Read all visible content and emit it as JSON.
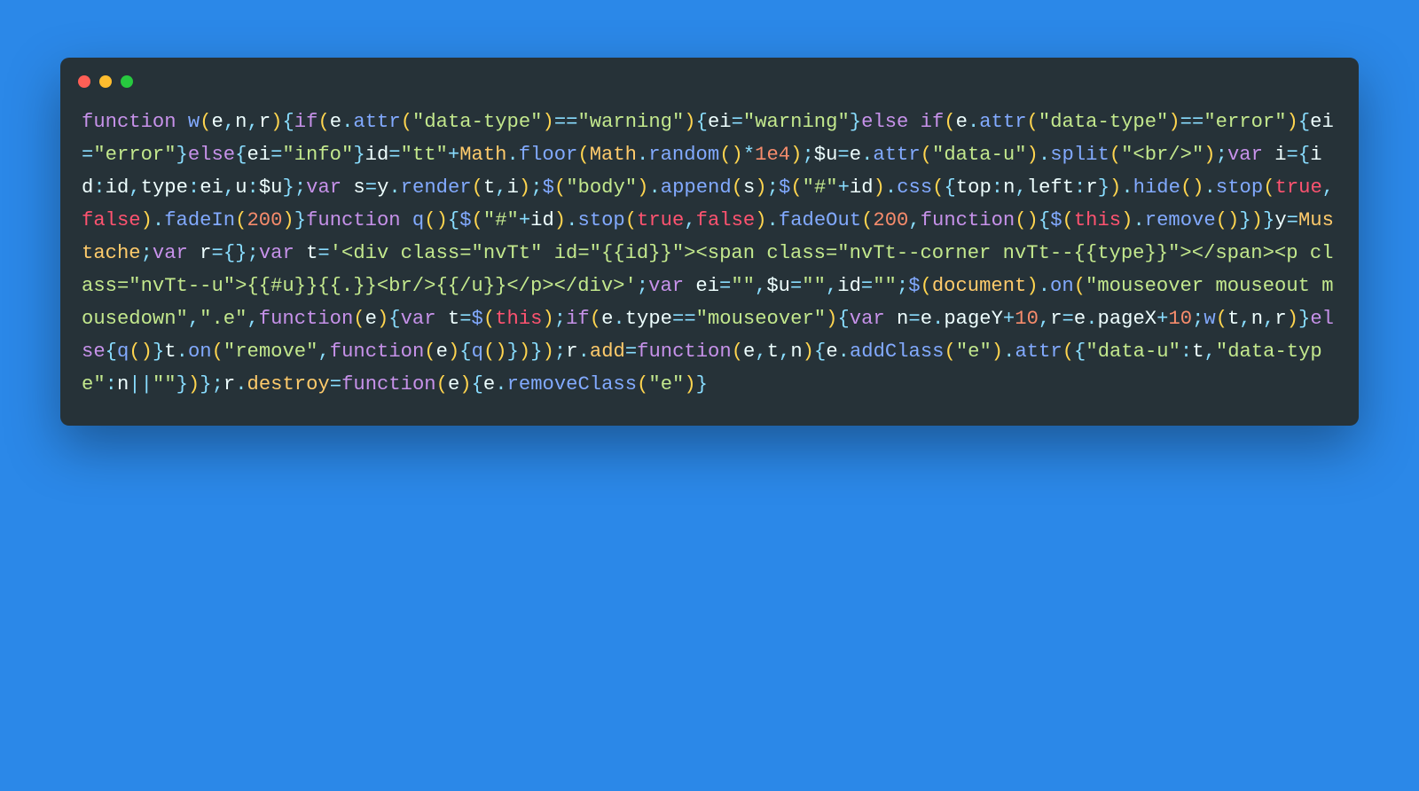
{
  "colors": {
    "page_bg": "#2b88e8",
    "window_bg": "#263238",
    "dot_red": "#ff5f56",
    "dot_yellow": "#ffbd2e",
    "dot_green": "#27c93f"
  },
  "syntax_colors": {
    "keyword": "#c792ea",
    "function": "#82aaff",
    "identifier": "#ffcb6b",
    "paren": "#ffd54f",
    "punct": "#89ddff",
    "string": "#c3e88d",
    "number": "#f78c6c",
    "plain": "#eeffff",
    "this_bool": "#ff5370"
  },
  "code": {
    "raw": "function w(e,n,r){if(e.attr(\"data-type\")==\"warning\"){ei=\"warning\"}else if(e.attr(\"data-type\")==\"error\"){ei=\"error\"}else{ei=\"info\"}id=\"tt\"+Math.floor(Math.random()*1e4);$u=e.attr(\"data-u\").split(\"<br/>\");var i={id:id,type:ei,u:$u};var s=y.render(t,i);$(\"body\").append(s);$(\"#\"+id).css({top:n,left:r}).hide().stop(true,false).fadeIn(200)}function q(){$(\"#\"+id).stop(true,false).fadeOut(200,function(){$(this).remove()})}y=Mustache;var r={};var t='<div class=\"nvTt\" id=\"{{id}}\"><span class=\"nvTt--corner nvTt--{{type}}\"></span><p class=\"nvTt--u\">{{#u}}{{.}}<br/>{{/u}}</p></div>';var ei=\"\",$u=\"\",id=\"\";$(document).on(\"mouseover mouseout mousedown\",\".e\",function(e){var t=$(this);if(e.type==\"mouseover\"){var n=e.pageY+10,r=e.pageX+10;w(t,n,r)}else{q()}t.on(\"remove\",function(e){q()})});r.add=function(e,t,n){e.addClass(\"e\").attr({\"data-u\":t,\"data-type\":n||\"\"})};r.destroy=function(e){e.removeClass(\"e\")}",
    "tokens": [
      [
        "kw",
        "function "
      ],
      [
        "fn",
        "w"
      ],
      [
        "pr",
        "("
      ],
      [
        "pl",
        "e"
      ],
      [
        "pu",
        ","
      ],
      [
        "pl",
        "n"
      ],
      [
        "pu",
        ","
      ],
      [
        "pl",
        "r"
      ],
      [
        "pr",
        ")"
      ],
      [
        "br",
        "{"
      ],
      [
        "kw",
        "if"
      ],
      [
        "pr",
        "("
      ],
      [
        "pl",
        "e"
      ],
      [
        "pu",
        "."
      ],
      [
        "fn",
        "attr"
      ],
      [
        "pr",
        "("
      ],
      [
        "st",
        "\"data-type\""
      ],
      [
        "pr",
        ")"
      ],
      [
        "pu",
        "=="
      ],
      [
        "st",
        "\"warning\""
      ],
      [
        "pr",
        ")"
      ],
      [
        "br",
        "{"
      ],
      [
        "pl",
        "ei"
      ],
      [
        "pu",
        "="
      ],
      [
        "st",
        "\"warning\""
      ],
      [
        "br",
        "}"
      ],
      [
        "kw",
        "else if"
      ],
      [
        "pr",
        "("
      ],
      [
        "pl",
        "e"
      ],
      [
        "pu",
        "."
      ],
      [
        "fn",
        "attr"
      ],
      [
        "pr",
        "("
      ],
      [
        "st",
        "\"data-type\""
      ],
      [
        "pr",
        ")"
      ],
      [
        "pu",
        "=="
      ],
      [
        "st",
        "\"error\""
      ],
      [
        "pr",
        ")"
      ],
      [
        "br",
        "{"
      ],
      [
        "pl",
        "ei"
      ],
      [
        "pu",
        "="
      ],
      [
        "st",
        "\"error\""
      ],
      [
        "br",
        "}"
      ],
      [
        "kw",
        "else"
      ],
      [
        "br",
        "{"
      ],
      [
        "pl",
        "ei"
      ],
      [
        "pu",
        "="
      ],
      [
        "st",
        "\"info\""
      ],
      [
        "br",
        "}"
      ],
      [
        "pl",
        "id"
      ],
      [
        "pu",
        "="
      ],
      [
        "st",
        "\"tt\""
      ],
      [
        "pu",
        "+"
      ],
      [
        "id",
        "Math"
      ],
      [
        "pu",
        "."
      ],
      [
        "fn",
        "floor"
      ],
      [
        "pr",
        "("
      ],
      [
        "id",
        "Math"
      ],
      [
        "pu",
        "."
      ],
      [
        "fn",
        "random"
      ],
      [
        "pr",
        "("
      ],
      [
        "pr",
        ")"
      ],
      [
        "pu",
        "*"
      ],
      [
        "nu",
        "1e4"
      ],
      [
        "pr",
        ")"
      ],
      [
        "pu",
        ";"
      ],
      [
        "pl",
        "$u"
      ],
      [
        "pu",
        "="
      ],
      [
        "pl",
        "e"
      ],
      [
        "pu",
        "."
      ],
      [
        "fn",
        "attr"
      ],
      [
        "pr",
        "("
      ],
      [
        "st",
        "\"data-u\""
      ],
      [
        "pr",
        ")"
      ],
      [
        "pu",
        "."
      ],
      [
        "fn",
        "split"
      ],
      [
        "pr",
        "("
      ],
      [
        "st",
        "\"<br/>\""
      ],
      [
        "pr",
        ")"
      ],
      [
        "pu",
        ";"
      ],
      [
        "kw",
        "var "
      ],
      [
        "pl",
        "i"
      ],
      [
        "pu",
        "="
      ],
      [
        "br",
        "{"
      ],
      [
        "pl",
        "id"
      ],
      [
        "pu",
        ":"
      ],
      [
        "pl",
        "id"
      ],
      [
        "pu",
        ","
      ],
      [
        "pl",
        "type"
      ],
      [
        "pu",
        ":"
      ],
      [
        "pl",
        "ei"
      ],
      [
        "pu",
        ","
      ],
      [
        "pl",
        "u"
      ],
      [
        "pu",
        ":"
      ],
      [
        "pl",
        "$u"
      ],
      [
        "br",
        "}"
      ],
      [
        "pu",
        ";"
      ],
      [
        "kw",
        "var "
      ],
      [
        "pl",
        "s"
      ],
      [
        "pu",
        "="
      ],
      [
        "pl",
        "y"
      ],
      [
        "pu",
        "."
      ],
      [
        "fn",
        "render"
      ],
      [
        "pr",
        "("
      ],
      [
        "pl",
        "t"
      ],
      [
        "pu",
        ","
      ],
      [
        "pl",
        "i"
      ],
      [
        "pr",
        ")"
      ],
      [
        "pu",
        ";"
      ],
      [
        "fn",
        "$"
      ],
      [
        "pr",
        "("
      ],
      [
        "st",
        "\"body\""
      ],
      [
        "pr",
        ")"
      ],
      [
        "pu",
        "."
      ],
      [
        "fn",
        "append"
      ],
      [
        "pr",
        "("
      ],
      [
        "pl",
        "s"
      ],
      [
        "pr",
        ")"
      ],
      [
        "pu",
        ";"
      ],
      [
        "fn",
        "$"
      ],
      [
        "pr",
        "("
      ],
      [
        "st",
        "\"#\""
      ],
      [
        "pu",
        "+"
      ],
      [
        "pl",
        "id"
      ],
      [
        "pr",
        ")"
      ],
      [
        "pu",
        "."
      ],
      [
        "fn",
        "css"
      ],
      [
        "pr",
        "("
      ],
      [
        "br",
        "{"
      ],
      [
        "pl",
        "top"
      ],
      [
        "pu",
        ":"
      ],
      [
        "pl",
        "n"
      ],
      [
        "pu",
        ","
      ],
      [
        "pl",
        "left"
      ],
      [
        "pu",
        ":"
      ],
      [
        "pl",
        "r"
      ],
      [
        "br",
        "}"
      ],
      [
        "pr",
        ")"
      ],
      [
        "pu",
        "."
      ],
      [
        "fn",
        "hide"
      ],
      [
        "pr",
        "("
      ],
      [
        "pr",
        ")"
      ],
      [
        "pu",
        "."
      ],
      [
        "fn",
        "stop"
      ],
      [
        "pr",
        "("
      ],
      [
        "th",
        "true"
      ],
      [
        "pu",
        ","
      ],
      [
        "th",
        "false"
      ],
      [
        "pr",
        ")"
      ],
      [
        "pu",
        "."
      ],
      [
        "fn",
        "fadeIn"
      ],
      [
        "pr",
        "("
      ],
      [
        "nu",
        "200"
      ],
      [
        "pr",
        ")"
      ],
      [
        "br",
        "}"
      ],
      [
        "kw",
        "function "
      ],
      [
        "fn",
        "q"
      ],
      [
        "pr",
        "("
      ],
      [
        "pr",
        ")"
      ],
      [
        "br",
        "{"
      ],
      [
        "fn",
        "$"
      ],
      [
        "pr",
        "("
      ],
      [
        "st",
        "\"#\""
      ],
      [
        "pu",
        "+"
      ],
      [
        "pl",
        "id"
      ],
      [
        "pr",
        ")"
      ],
      [
        "pu",
        "."
      ],
      [
        "fn",
        "stop"
      ],
      [
        "pr",
        "("
      ],
      [
        "th",
        "true"
      ],
      [
        "pu",
        ","
      ],
      [
        "th",
        "false"
      ],
      [
        "pr",
        ")"
      ],
      [
        "pu",
        "."
      ],
      [
        "fn",
        "fadeOut"
      ],
      [
        "pr",
        "("
      ],
      [
        "nu",
        "200"
      ],
      [
        "pu",
        ","
      ],
      [
        "kw",
        "function"
      ],
      [
        "pr",
        "("
      ],
      [
        "pr",
        ")"
      ],
      [
        "br",
        "{"
      ],
      [
        "fn",
        "$"
      ],
      [
        "pr",
        "("
      ],
      [
        "th",
        "this"
      ],
      [
        "pr",
        ")"
      ],
      [
        "pu",
        "."
      ],
      [
        "fn",
        "remove"
      ],
      [
        "pr",
        "("
      ],
      [
        "pr",
        ")"
      ],
      [
        "br",
        "}"
      ],
      [
        "pr",
        ")"
      ],
      [
        "br",
        "}"
      ],
      [
        "pl",
        "y"
      ],
      [
        "pu",
        "="
      ],
      [
        "id",
        "Mustache"
      ],
      [
        "pu",
        ";"
      ],
      [
        "kw",
        "var "
      ],
      [
        "pl",
        "r"
      ],
      [
        "pu",
        "="
      ],
      [
        "br",
        "{"
      ],
      [
        "br",
        "}"
      ],
      [
        "pu",
        ";"
      ],
      [
        "kw",
        "var "
      ],
      [
        "pl",
        "t"
      ],
      [
        "pu",
        "="
      ],
      [
        "st",
        "'<div class=\"nvTt\" id=\"{{id}}\"><span class=\"nvTt--corner nvTt--{{type}}\"></span><p class=\"nvTt--u\">{{#u}}{{.}}<br/>{{/u}}</p></div>'"
      ],
      [
        "pu",
        ";"
      ],
      [
        "kw",
        "var "
      ],
      [
        "pl",
        "ei"
      ],
      [
        "pu",
        "="
      ],
      [
        "st",
        "\"\""
      ],
      [
        "pu",
        ","
      ],
      [
        "pl",
        "$u"
      ],
      [
        "pu",
        "="
      ],
      [
        "st",
        "\"\""
      ],
      [
        "pu",
        ","
      ],
      [
        "pl",
        "id"
      ],
      [
        "pu",
        "="
      ],
      [
        "st",
        "\"\""
      ],
      [
        "pu",
        ";"
      ],
      [
        "fn",
        "$"
      ],
      [
        "pr",
        "("
      ],
      [
        "id",
        "document"
      ],
      [
        "pr",
        ")"
      ],
      [
        "pu",
        "."
      ],
      [
        "fn",
        "on"
      ],
      [
        "pr",
        "("
      ],
      [
        "st",
        "\"mouseover mouseout mousedown\""
      ],
      [
        "pu",
        ","
      ],
      [
        "st",
        "\".e\""
      ],
      [
        "pu",
        ","
      ],
      [
        "kw",
        "function"
      ],
      [
        "pr",
        "("
      ],
      [
        "pl",
        "e"
      ],
      [
        "pr",
        ")"
      ],
      [
        "br",
        "{"
      ],
      [
        "kw",
        "var "
      ],
      [
        "pl",
        "t"
      ],
      [
        "pu",
        "="
      ],
      [
        "fn",
        "$"
      ],
      [
        "pr",
        "("
      ],
      [
        "th",
        "this"
      ],
      [
        "pr",
        ")"
      ],
      [
        "pu",
        ";"
      ],
      [
        "kw",
        "if"
      ],
      [
        "pr",
        "("
      ],
      [
        "pl",
        "e"
      ],
      [
        "pu",
        "."
      ],
      [
        "pl",
        "type"
      ],
      [
        "pu",
        "=="
      ],
      [
        "st",
        "\"mouseover\""
      ],
      [
        "pr",
        ")"
      ],
      [
        "br",
        "{"
      ],
      [
        "kw",
        "var "
      ],
      [
        "pl",
        "n"
      ],
      [
        "pu",
        "="
      ],
      [
        "pl",
        "e"
      ],
      [
        "pu",
        "."
      ],
      [
        "pl",
        "pageY"
      ],
      [
        "pu",
        "+"
      ],
      [
        "nu",
        "10"
      ],
      [
        "pu",
        ","
      ],
      [
        "pl",
        "r"
      ],
      [
        "pu",
        "="
      ],
      [
        "pl",
        "e"
      ],
      [
        "pu",
        "."
      ],
      [
        "pl",
        "pageX"
      ],
      [
        "pu",
        "+"
      ],
      [
        "nu",
        "10"
      ],
      [
        "pu",
        ";"
      ],
      [
        "fn",
        "w"
      ],
      [
        "pr",
        "("
      ],
      [
        "pl",
        "t"
      ],
      [
        "pu",
        ","
      ],
      [
        "pl",
        "n"
      ],
      [
        "pu",
        ","
      ],
      [
        "pl",
        "r"
      ],
      [
        "pr",
        ")"
      ],
      [
        "br",
        "}"
      ],
      [
        "kw",
        "else"
      ],
      [
        "br",
        "{"
      ],
      [
        "fn",
        "q"
      ],
      [
        "pr",
        "("
      ],
      [
        "pr",
        ")"
      ],
      [
        "br",
        "}"
      ],
      [
        "pl",
        "t"
      ],
      [
        "pu",
        "."
      ],
      [
        "fn",
        "on"
      ],
      [
        "pr",
        "("
      ],
      [
        "st",
        "\"remove\""
      ],
      [
        "pu",
        ","
      ],
      [
        "kw",
        "function"
      ],
      [
        "pr",
        "("
      ],
      [
        "pl",
        "e"
      ],
      [
        "pr",
        ")"
      ],
      [
        "br",
        "{"
      ],
      [
        "fn",
        "q"
      ],
      [
        "pr",
        "("
      ],
      [
        "pr",
        ")"
      ],
      [
        "br",
        "}"
      ],
      [
        "pr",
        ")"
      ],
      [
        "br",
        "}"
      ],
      [
        "pr",
        ")"
      ],
      [
        "pu",
        ";"
      ],
      [
        "pl",
        "r"
      ],
      [
        "pu",
        "."
      ],
      [
        "id",
        "add"
      ],
      [
        "pu",
        "="
      ],
      [
        "kw",
        "function"
      ],
      [
        "pr",
        "("
      ],
      [
        "pl",
        "e"
      ],
      [
        "pu",
        ","
      ],
      [
        "pl",
        "t"
      ],
      [
        "pu",
        ","
      ],
      [
        "pl",
        "n"
      ],
      [
        "pr",
        ")"
      ],
      [
        "br",
        "{"
      ],
      [
        "pl",
        "e"
      ],
      [
        "pu",
        "."
      ],
      [
        "fn",
        "addClass"
      ],
      [
        "pr",
        "("
      ],
      [
        "st",
        "\"e\""
      ],
      [
        "pr",
        ")"
      ],
      [
        "pu",
        "."
      ],
      [
        "fn",
        "attr"
      ],
      [
        "pr",
        "("
      ],
      [
        "br",
        "{"
      ],
      [
        "st",
        "\"data-u\""
      ],
      [
        "pu",
        ":"
      ],
      [
        "pl",
        "t"
      ],
      [
        "pu",
        ","
      ],
      [
        "st",
        "\"data-type\""
      ],
      [
        "pu",
        ":"
      ],
      [
        "pl",
        "n"
      ],
      [
        "pu",
        "||"
      ],
      [
        "st",
        "\"\""
      ],
      [
        "br",
        "}"
      ],
      [
        "pr",
        ")"
      ],
      [
        "br",
        "}"
      ],
      [
        "pu",
        ";"
      ],
      [
        "pl",
        "r"
      ],
      [
        "pu",
        "."
      ],
      [
        "id",
        "destroy"
      ],
      [
        "pu",
        "="
      ],
      [
        "kw",
        "function"
      ],
      [
        "pr",
        "("
      ],
      [
        "pl",
        "e"
      ],
      [
        "pr",
        ")"
      ],
      [
        "br",
        "{"
      ],
      [
        "pl",
        "e"
      ],
      [
        "pu",
        "."
      ],
      [
        "fn",
        "removeClass"
      ],
      [
        "pr",
        "("
      ],
      [
        "st",
        "\"e\""
      ],
      [
        "pr",
        ")"
      ],
      [
        "br",
        "}"
      ]
    ]
  }
}
